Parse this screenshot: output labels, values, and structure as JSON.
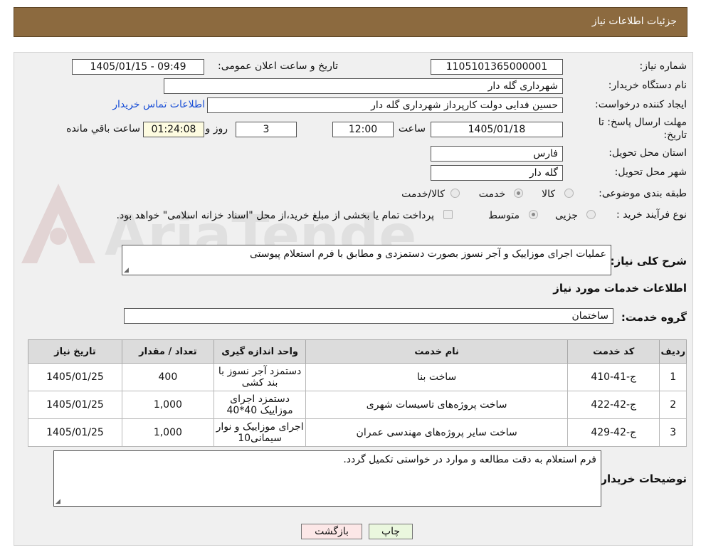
{
  "header": {
    "title": "جزئیات اطلاعات نیاز"
  },
  "watermark_text": "AriaTender.neT",
  "fields": {
    "need_number_label": "شماره نیاز:",
    "need_number": "1105101365000001",
    "announce_label": "تاریخ و ساعت اعلان عمومی:",
    "announce_value": "1405/01/15 - 09:49",
    "buyer_org_label": "نام دستگاه خریدار:",
    "buyer_org": "شهرداری گله دار",
    "requester_label": "ایجاد کننده درخواست:",
    "requester": "حسین فدایی دولت کارپرداز شهرداری گله دار",
    "contact_link": "اطلاعات تماس خریدار",
    "deadline_label_1": "مهلت ارسال پاسخ: تا",
    "deadline_label_2": "تاریخ:",
    "deadline_date": "1405/01/18",
    "time_label": "ساعت",
    "deadline_time": "12:00",
    "days_value": "3",
    "days_label": "روز و",
    "remaining_time": "01:24:08",
    "remaining_label": "ساعت باقي مانده",
    "province_label": "استان محل تحویل:",
    "province": "فارس",
    "city_label": "شهر محل تحویل:",
    "city": "گله دار",
    "category_label": "طبقه بندی موضوعی:",
    "category_options": [
      "کالا",
      "خدمت",
      "کالا/خدمت"
    ],
    "category_selected": "خدمت",
    "process_label": "نوع فرآیند خرید :",
    "process_options": [
      "جزیی",
      "متوسط"
    ],
    "process_selected": "متوسط",
    "payment_note": "پرداخت تمام یا بخشی از مبلغ خرید،از محل \"اسناد خزانه اسلامی\" خواهد بود.",
    "summary_label": "شرح کلی نیاز:",
    "summary": "عملیات اجرای موزاییک و آجر نسوز بصورت دستمزدی و مطابق با فرم استعلام پیوستی",
    "services_heading": "اطلاعات خدمات مورد نیاز",
    "service_group_label": "گروه خدمت:",
    "service_group": "ساختمان",
    "buyer_notes_label": "توضیحات خریدار:",
    "buyer_notes": "فرم استعلام به دقت مطالعه و موارد در خواستی تکمیل گردد."
  },
  "table": {
    "headers": [
      "ردیف",
      "کد خدمت",
      "نام خدمت",
      "واحد اندازه گیری",
      "تعداد / مقدار",
      "تاریخ نیاز"
    ],
    "rows": [
      [
        "1",
        "ج-41-410",
        "ساخت بنا",
        "دستمزد آجر نسوز با بند کشی",
        "400",
        "1405/01/25"
      ],
      [
        "2",
        "ج-42-422",
        "ساخت پروژه‌های تاسیسات شهری",
        "دستمزد اجرای موزاییک 40*40",
        "1,000",
        "1405/01/25"
      ],
      [
        "3",
        "ج-42-429",
        "ساخت سایر پروژه‌های مهندسی عمران",
        "اجرای موزاییک و نوار سیمانی10",
        "1,000",
        "1405/01/25"
      ]
    ]
  },
  "buttons": {
    "print": "چاپ",
    "back": "بازگشت"
  },
  "colors": {
    "header_bg": "#8c6a3f",
    "print_bg": "#eaf7de",
    "back_bg": "#fce7e7",
    "link": "#1a4fd6"
  }
}
